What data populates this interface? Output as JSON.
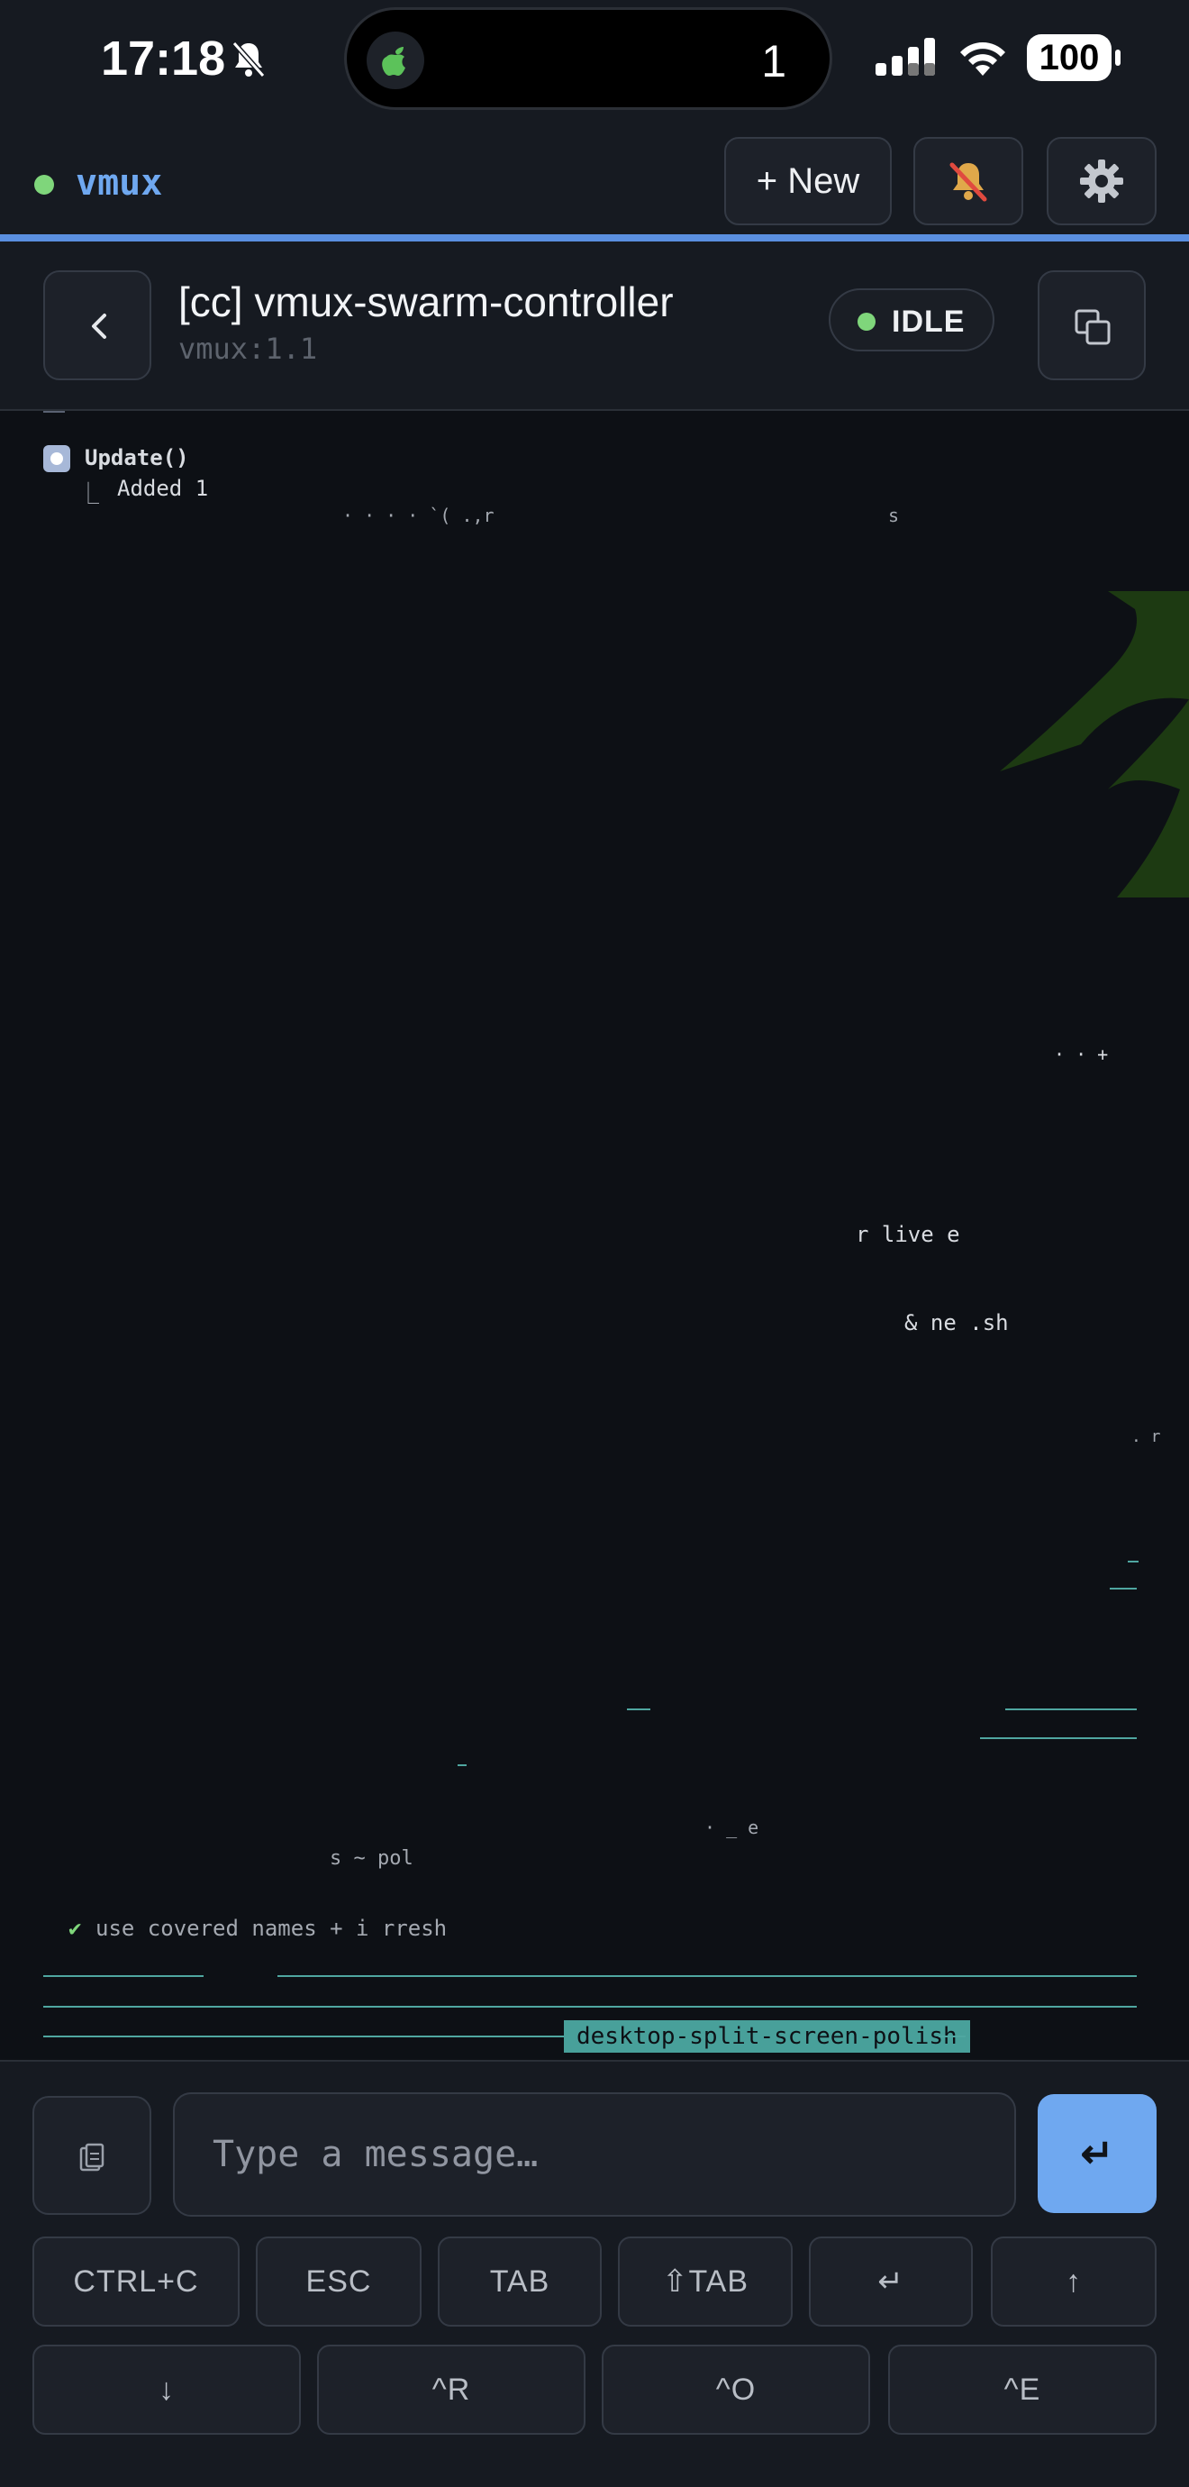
{
  "status_bar": {
    "time": "17:18",
    "island_count": "1",
    "battery": "100"
  },
  "app": {
    "name": "vmux",
    "new_label": "+ New"
  },
  "session": {
    "title": "[cc] vmux-swarm-controller",
    "subtitle": "vmux:1.1",
    "status": "IDLE"
  },
  "terminal": {
    "tool_call": "Update()",
    "tool_result": "Added 1",
    "frag_a": "· ·   ·  · `(  .,r",
    "frag_b": "s",
    "frag_c": "· · +",
    "frag_d": "r      live e",
    "frag_e": "& ne      .sh",
    "frag_f": ".  r",
    "frag_g": "s        ~      pol",
    "frag_h": "·  _ e",
    "check_mark": "✔",
    "check_line": "use                  covered names + i   rresh",
    "branch": "desktop-split-screen-polish"
  },
  "composer": {
    "placeholder": "Type a message…",
    "send_label": "↵",
    "keys_row1": [
      "CTRL+C",
      "ESC",
      "TAB",
      "⇧TAB",
      "↵",
      "↑"
    ],
    "keys_row2": [
      "↓",
      "^R",
      "^O",
      "^E"
    ]
  },
  "colors": {
    "accent": "#6fa8f0",
    "online": "#7fd67b",
    "terminal_line": "#4fa6a0",
    "background": "#0d1015"
  }
}
